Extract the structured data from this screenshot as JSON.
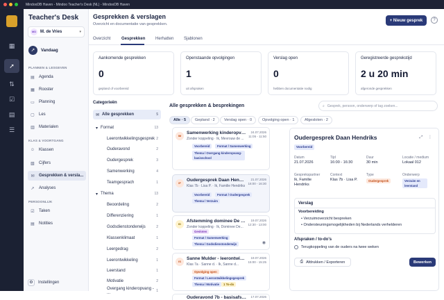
{
  "window": {
    "title": "MindooDB Haven - Mindoo Teacher's Desk (NL) - MindooDB Haven"
  },
  "sidebar": {
    "brand": "Teacher's Desk",
    "user": {
      "initials": "MD",
      "name": "M. de Vries"
    },
    "today_label": "Vandaag",
    "section1": "PLANNEN & LESGEVEN",
    "section2": "KLAS & VOORTGANG",
    "section3": "PERSOONLIJK",
    "items": [
      {
        "label": "Agenda"
      },
      {
        "label": "Rooster"
      },
      {
        "label": "Planning"
      },
      {
        "label": "Les"
      },
      {
        "label": "Materialen"
      },
      {
        "label": "Klassen"
      },
      {
        "label": "Cijfers"
      },
      {
        "label": "Gesprekken & versla..."
      },
      {
        "label": "Analyses"
      },
      {
        "label": "Taken"
      },
      {
        "label": "Notities"
      }
    ],
    "settings_label": "Instellingen"
  },
  "header": {
    "title": "Gesprekken & verslagen",
    "subtitle": "Overzicht en documentatie van gesprekken.",
    "new_button": "+ Nieuw gesprek",
    "help": "?"
  },
  "tabs": [
    "Overzicht",
    "Gesprekken",
    "Herhatten",
    "Sjablonen"
  ],
  "stats": [
    {
      "title": "Aankomende gesprekken",
      "value": "0",
      "sub": "gepland of voorbereid"
    },
    {
      "title": "Openstaande opvolgingen",
      "value": "1",
      "sub": "uit afspraken"
    },
    {
      "title": "Verslag open",
      "value": "0",
      "sub": "hebben documentatie nodig"
    },
    {
      "title": "Geregistreerde gesprekstijd",
      "value": "2 u 20 min",
      "sub": "afgeronde gesprekken"
    }
  ],
  "categories": {
    "heading": "Categorieën",
    "all": {
      "label": "Alle gesprekken",
      "count": "5"
    },
    "format": {
      "label": "Format",
      "count": "13"
    },
    "format_items": [
      {
        "label": "Leerontwikkelingsgesprek",
        "count": "2"
      },
      {
        "label": "Ouderavond",
        "count": "2"
      },
      {
        "label": "Oudergesprek",
        "count": "3"
      },
      {
        "label": "Samenwerking",
        "count": "4"
      },
      {
        "label": "Teamgesprach",
        "count": "1"
      }
    ],
    "thema": {
      "label": "Thema",
      "count": "13"
    },
    "thema_items": [
      {
        "label": "Beoordeling",
        "count": "2"
      },
      {
        "label": "Differenziering",
        "count": "1"
      },
      {
        "label": "Godsdienstonderwijs",
        "count": "2"
      },
      {
        "label": "Klassenklimaat",
        "count": "1"
      },
      {
        "label": "Leergedrag",
        "count": "2"
      },
      {
        "label": "Leerontwikkeling",
        "count": "1"
      },
      {
        "label": "Leerstand",
        "count": "1"
      },
      {
        "label": "Motivatie",
        "count": "2"
      },
      {
        "label": "Overgang kinderopvang - ...",
        "count": "1"
      }
    ]
  },
  "list": {
    "heading": "Alle gesprekken & besprekingen",
    "search_placeholder": "Gesprek, persoon, onderwerp of tag zoeken...",
    "filters": [
      "Alle · 5",
      "Gepland · 2",
      "Verslag open · 0",
      "Opvolging open · 1",
      "Afgesloten · 2"
    ],
    "items": [
      {
        "icon": "IM",
        "title": "Samenwerking kinderopvang - ...",
        "date": "24.07.2026",
        "time": "11:05 - 11:50",
        "sub": "Zonder koppeling · Ik, Mevrouw de ...",
        "tags": [
          "Voorbereid",
          "Format / Samenwerking",
          "Thema / Overgang kinderopvang-basisschool"
        ]
      },
      {
        "icon": "IF",
        "title": "Oudergesprek Daan Hendriks",
        "date": "21.07.2026",
        "time": "16:00 - 16:30",
        "sub": "Klas 7b · Lisa P. · Ik, Familie Hendriks",
        "tags": [
          "Voorbereid",
          "Format / Oudergesprek",
          "Thema / Verzuim"
        ]
      },
      {
        "icon": "ID",
        "title": "Afstemming dominee De Wit ...",
        "date": "19.07.2026",
        "time": "12:30 - 13:00",
        "sub": "Zonder koppeling · Ik, Dominee De...",
        "tags": [
          "Gesloten",
          "Format / Samenwerking",
          "Thema / Godsdienstonderwijs"
        ]
      },
      {
        "icon": "IS",
        "title": "Sanne Mulder - leerontwikke...",
        "date": "19.07.2026",
        "time": "15:00 - 15:25",
        "sub": "Klas 7a · Sanne d. · Ik, Sanne d...",
        "tags": [
          "Opvolging open",
          "Format / Leerontwikkelingsgesprek",
          "Thema / Motivatie",
          "1 To-do"
        ]
      },
      {
        "icon": "IO",
        "title": "Ouderavond 7b - basisafsprak...",
        "date": "17.07.2026",
        "time": "",
        "sub": "",
        "tags": []
      }
    ]
  },
  "detail": {
    "title": "Oudergesprek Daan Hendriks",
    "status": "Voorbereid",
    "fields": [
      {
        "label": "Datum",
        "value": "21.07.2026"
      },
      {
        "label": "Tijd",
        "value": "16:00 - 16:30"
      },
      {
        "label": "Duur",
        "value": "30 min"
      },
      {
        "label": "Locatie / medium",
        "value": "Lokaal 012"
      },
      {
        "label": "Gesprekspartner",
        "value": "Ik, Familie Hendriks"
      },
      {
        "label": "Context",
        "value": "Klas 7b · Lisa P."
      },
      {
        "label": "Type",
        "value": "Oudergesprek"
      },
      {
        "label": "Onderwerp",
        "value": "Verzuim en leerstand"
      }
    ],
    "verslag_heading": "Verslag",
    "voorbereiding_heading": "Voorbereiding",
    "bullets": [
      "Verzuimoverzicht bespreken",
      "Ondersteuningsmogelijkheden bij Nederlands verhelderen"
    ],
    "afspraken_heading": "Afspraken / to-do's",
    "todo": "Terugkoppeling van de ouders na twee weken",
    "print_button": "Afdrukken / Exporteren",
    "edit_button": "Bewerken"
  },
  "colors": {
    "accent": "#2a3a78",
    "sidebar": "#1b2133"
  }
}
